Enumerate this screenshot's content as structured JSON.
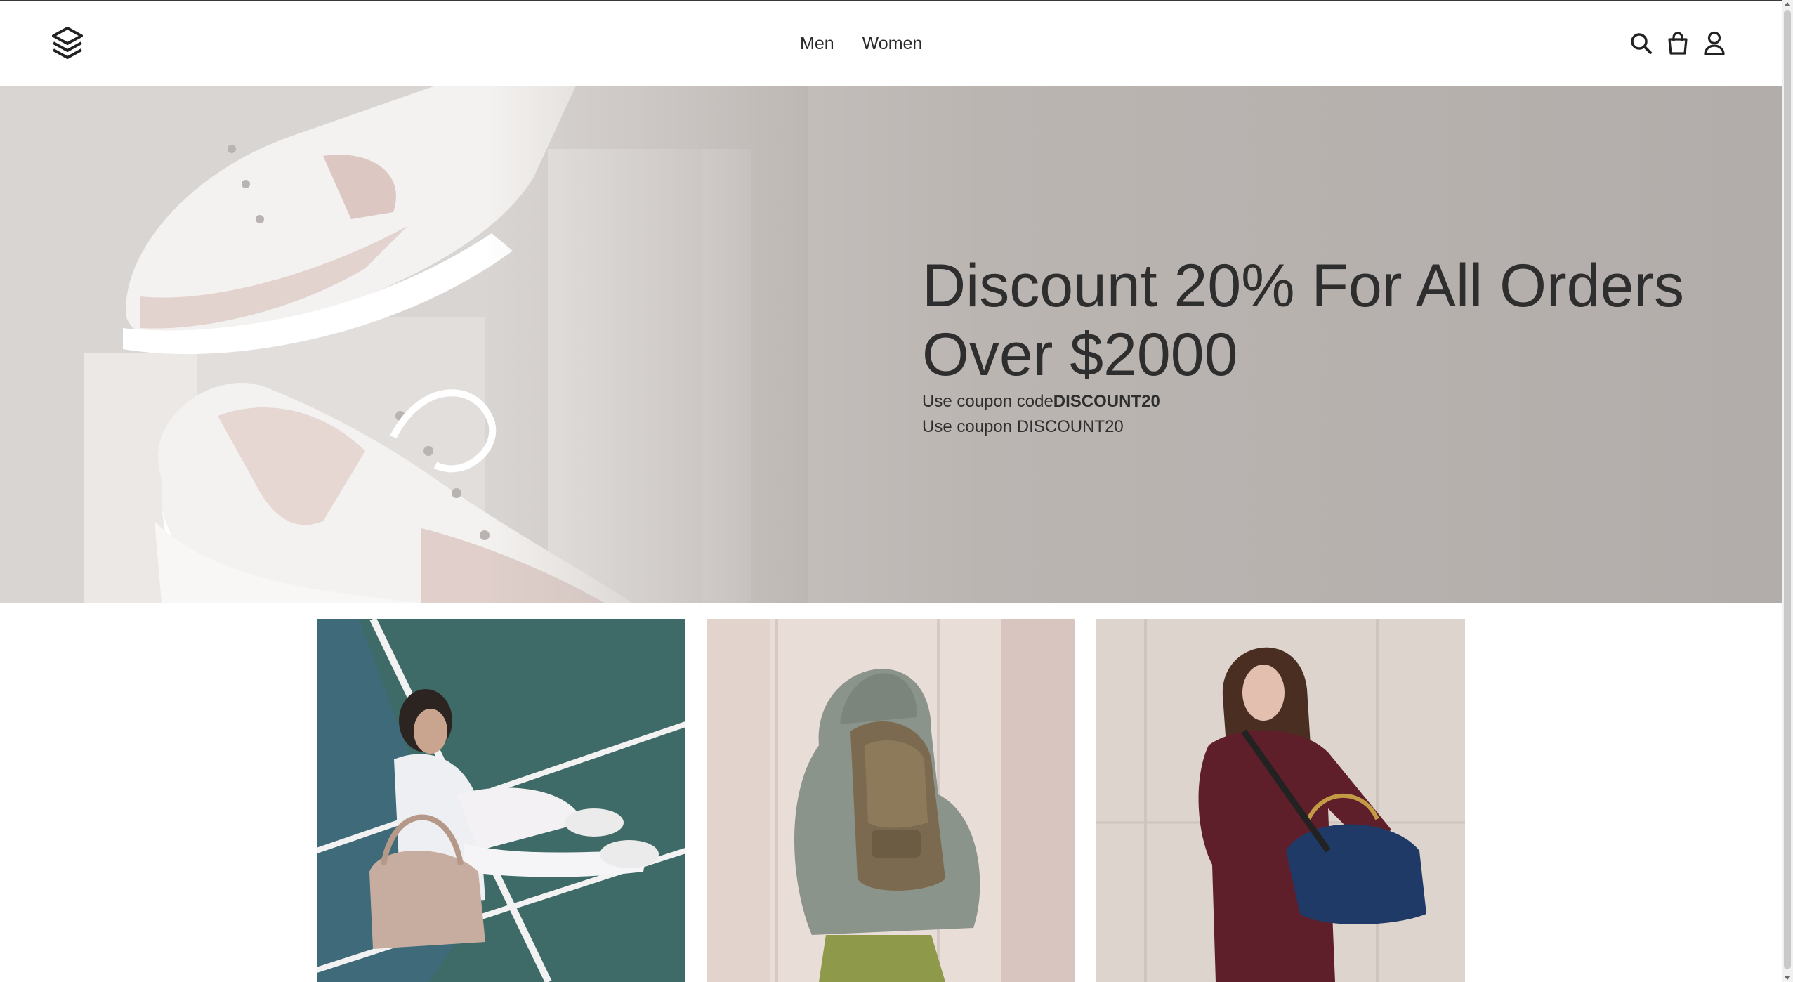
{
  "nav": {
    "items": [
      {
        "label": "Men"
      },
      {
        "label": "Women"
      }
    ]
  },
  "header_icons": [
    "logo-icon",
    "search-icon",
    "cart-icon",
    "user-icon"
  ],
  "hero": {
    "title": "Discount 20% For All Orders Over $2000",
    "line1_prefix": "Use coupon code",
    "line1_code": "DISCOUNT20",
    "line2": "Use coupon DISCOUNT20"
  },
  "products": [
    {
      "name": "tennis-court-bag-photo"
    },
    {
      "name": "backpack-photo"
    },
    {
      "name": "duffel-bag-photo"
    }
  ],
  "colors": {
    "text": "#2e2e2e",
    "hero_bg": "#b8b2af"
  }
}
